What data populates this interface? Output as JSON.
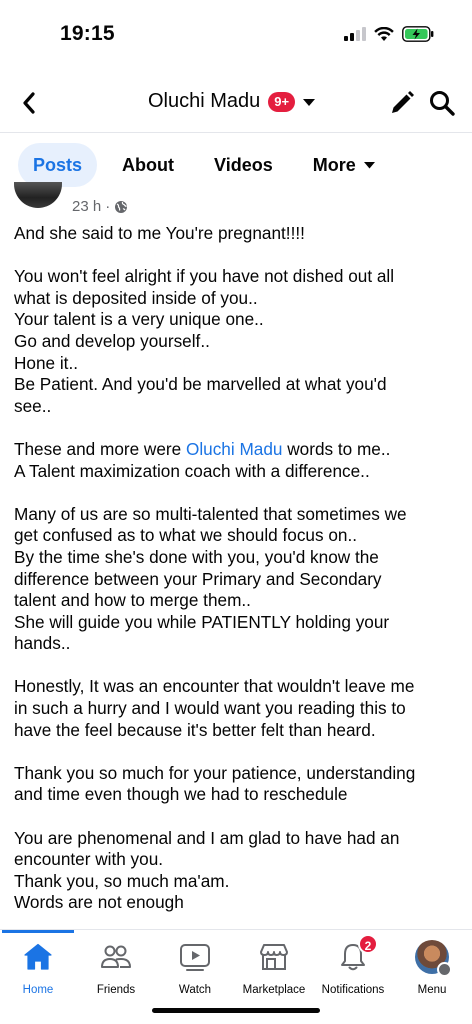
{
  "status_bar": {
    "time": "19:15",
    "icons": [
      "signal-icon",
      "wifi-icon",
      "battery-charging-icon"
    ],
    "battery_color": "#34c759"
  },
  "header": {
    "title": "Oluchi Madu",
    "badge": "9+",
    "icons": [
      "back-arrow-icon",
      "caret-down-icon",
      "pencil-icon",
      "search-icon"
    ]
  },
  "tabs": [
    {
      "label": "Posts",
      "active": true
    },
    {
      "label": "About",
      "active": false
    },
    {
      "label": "Videos",
      "active": false
    },
    {
      "label": "More",
      "active": false
    }
  ],
  "post": {
    "time": "23 h",
    "separator": "·",
    "privacy_icon": "globe-icon",
    "lines": [
      "And she said to me You're pregnant!!!!",
      "",
      "You won't feel alright if you have not dished out all",
      "what is deposited inside of you..",
      "Your talent is a very unique one..",
      "Go and develop yourself..",
      "Hone it..",
      "Be Patient. And you'd be marvelled at what you'd",
      "see..",
      "",
      "",
      "A Talent maximization coach with a difference..",
      "",
      "Many of us are so multi-talented that sometimes we",
      "get confused as to what we should focus on..",
      "By the time she's done with you, you'd know the",
      "difference between your Primary and Secondary",
      "talent and how to merge them..",
      "She will guide you while PATIENTLY holding your",
      "hands..",
      "",
      "Honestly, It was an encounter that wouldn't leave me",
      "in such a hurry and I would want you reading this to",
      "have the feel because it's better felt than heard.",
      "",
      "Thank you so much for your patience, understanding",
      "and time even though we had to reschedule",
      "",
      "You are phenomenal and I am glad to have had an",
      "encounter with you.",
      "Thank you, so much ma'am.",
      "Words are not enough"
    ],
    "mention_line": {
      "prefix": "These and more were ",
      "mention": "Oluchi Madu",
      "suffix": " words to me.."
    }
  },
  "bottom_nav": {
    "items": [
      {
        "label": "Home",
        "icon": "home-icon",
        "active": true
      },
      {
        "label": "Friends",
        "icon": "friends-icon",
        "active": false
      },
      {
        "label": "Watch",
        "icon": "watch-icon",
        "active": false
      },
      {
        "label": "Marketplace",
        "icon": "marketplace-icon",
        "active": false
      },
      {
        "label": "Notifications",
        "icon": "bell-icon",
        "active": false
      },
      {
        "label": "Menu",
        "icon": "profile-avatar",
        "active": false
      }
    ],
    "notifications_badge": "2",
    "accent_color": "#1b74e4"
  }
}
